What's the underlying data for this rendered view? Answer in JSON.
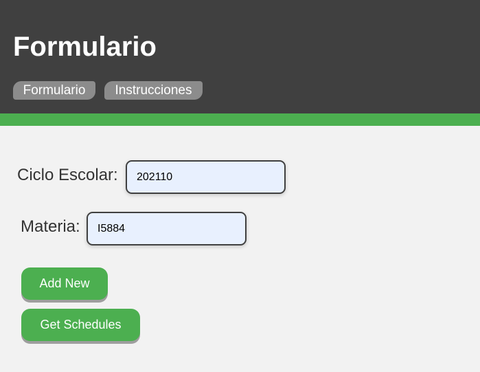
{
  "header": {
    "title": "Formulario",
    "tabs": [
      {
        "label": "Formulario"
      },
      {
        "label": "Instrucciones"
      }
    ]
  },
  "form": {
    "ciclo_escolar": {
      "label": "Ciclo Escolar:",
      "value": "202110"
    },
    "materia": {
      "label": "Materia:",
      "value": "I5884"
    }
  },
  "buttons": {
    "add_new": "Add New",
    "get_schedules": "Get Schedules"
  },
  "colors": {
    "header_bg": "#404040",
    "accent_green": "#4caf50",
    "tab_bg": "#8c8c8c",
    "page_bg": "#f2f2f2",
    "input_bg": "#e8f0fe"
  }
}
